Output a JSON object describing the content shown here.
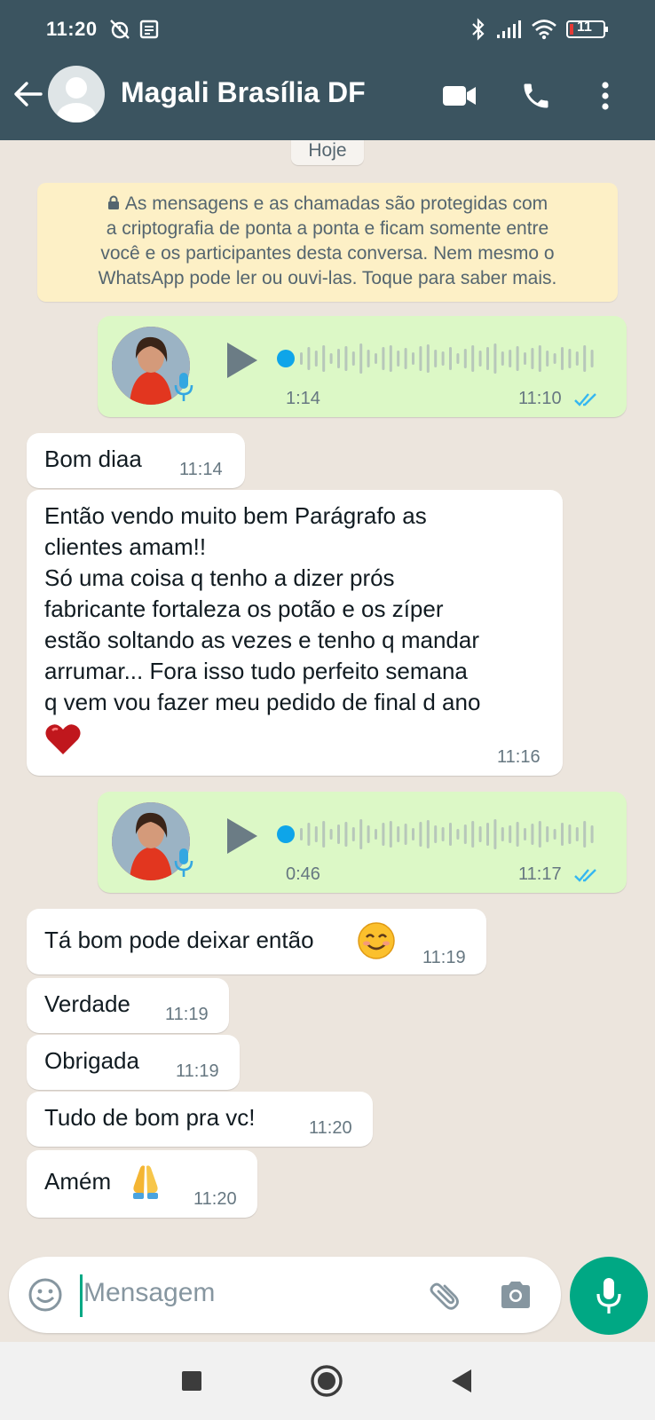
{
  "status_bar": {
    "time": "11:20",
    "battery": "11"
  },
  "header": {
    "contact_name": "Magali Brasília DF"
  },
  "chat": {
    "day_label": "Hoje",
    "encryption_notice_lines": [
      "As mensagens e as chamadas são protegidas com",
      "a criptografia de ponta a ponta e ficam somente entre",
      "você e os participantes desta conversa. Nem mesmo o",
      "WhatsApp pode ler ou ouvi-las. Toque para saber mais."
    ],
    "messages": [
      {
        "type": "voice",
        "direction": "out",
        "duration": "1:14",
        "time": "11:10",
        "read": true
      },
      {
        "type": "text",
        "direction": "in",
        "lines": [
          "Bom diaa"
        ],
        "time": "11:14"
      },
      {
        "type": "text",
        "direction": "in",
        "lines": [
          "Então vendo muito bem Parágrafo as",
          "clientes amam!!",
          "Só uma coisa q tenho a dizer prós",
          "fabricante fortaleza os potão e os zíper",
          "estão soltando as vezes e tenho q mandar",
          "arrumar... Fora isso tudo perfeito semana",
          "q vem vou fazer meu pedido de final d ano"
        ],
        "emoji": "heart",
        "time": "11:16"
      },
      {
        "type": "voice",
        "direction": "out",
        "duration": "0:46",
        "time": "11:17",
        "read": true
      },
      {
        "type": "text",
        "direction": "in",
        "lines": [
          "Tá bom pode deixar então"
        ],
        "emoji": "smiling-face",
        "time": "11:19"
      },
      {
        "type": "text",
        "direction": "in",
        "lines": [
          "Verdade"
        ],
        "time": "11:19"
      },
      {
        "type": "text",
        "direction": "in",
        "lines": [
          "Obrigada"
        ],
        "time": "11:19"
      },
      {
        "type": "text",
        "direction": "in",
        "lines": [
          "Tudo de bom pra vc!"
        ],
        "time": "11:20"
      },
      {
        "type": "text",
        "direction": "in",
        "lines": [
          "Amém"
        ],
        "emoji": "folded-hands",
        "time": "11:20"
      }
    ]
  },
  "input": {
    "placeholder": "Mensagem"
  },
  "colors": {
    "header": "#3b5460",
    "incoming": "#ffffff",
    "outgoing": "#dcf8c6",
    "accent": "#00a884",
    "notice": "#fdf0c6"
  }
}
